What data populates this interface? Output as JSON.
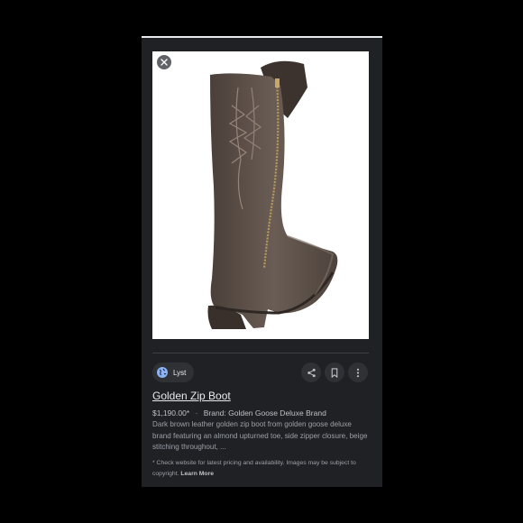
{
  "result": {
    "image_alt": "Golden Zip Boot",
    "source": {
      "label": "Lyst",
      "icon": "globe-icon"
    },
    "actions": {
      "share_icon": "share-icon",
      "save_icon": "bookmark-icon",
      "more_icon": "more-vert-icon"
    },
    "title": "Golden Zip Boot",
    "price": "$1,190.00*",
    "separator": "·",
    "brand": "Brand: Golden Goose Deluxe Brand",
    "description": "Dark brown leather golden zip boot from golden goose deluxe brand featuring an almond upturned toe, side zipper closure, beige stitching throughout, ...",
    "disclaimer": "* Check website for latest pricing and availability. Images may be subject to copyright.",
    "learn_more": "Learn More"
  },
  "colors": {
    "background": "#000000",
    "panel": "#202124",
    "chip": "#303134",
    "accent_globe": "#8ab4f8",
    "text_primary": "#e8eaed",
    "text_secondary": "#9aa0a6"
  }
}
